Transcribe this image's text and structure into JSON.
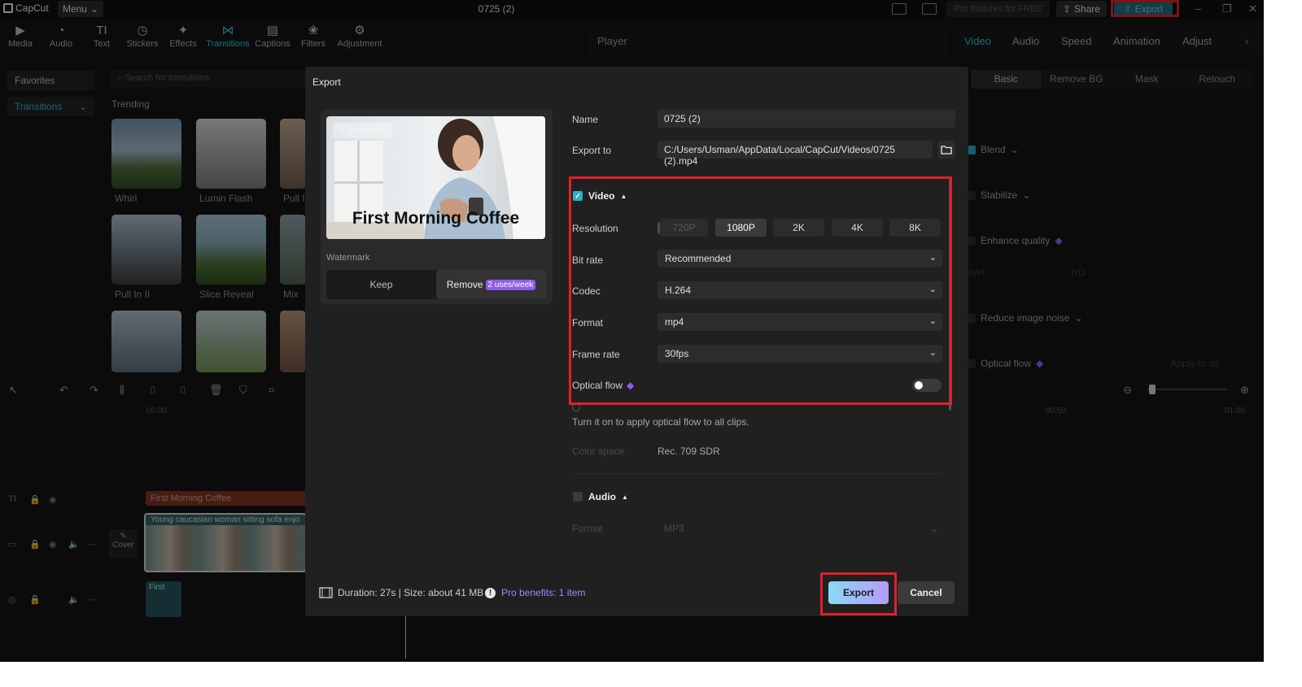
{
  "app": {
    "logo": "CapCut",
    "menu_label": "Menu",
    "project_title": "0725 (2)",
    "pro_features_label": "Pro features for FREE",
    "share_label": "Share",
    "export_label": "Export"
  },
  "toolbar": {
    "items": [
      {
        "label": "Media",
        "icon": "media-icon"
      },
      {
        "label": "Audio",
        "icon": "audio-icon"
      },
      {
        "label": "Text",
        "icon": "text-icon"
      },
      {
        "label": "Stickers",
        "icon": "stickers-icon"
      },
      {
        "label": "Effects",
        "icon": "effects-icon"
      },
      {
        "label": "Transitions",
        "icon": "transitions-icon",
        "active": true
      },
      {
        "label": "Captions",
        "icon": "captions-icon"
      },
      {
        "label": "Filters",
        "icon": "filters-icon"
      },
      {
        "label": "Adjustment",
        "icon": "adjustment-icon"
      }
    ]
  },
  "left_panel": {
    "nav": [
      "Favorites",
      "Transitions"
    ],
    "search_placeholder": "Search for transitions",
    "section": "Trending",
    "transitions": [
      "Whirl",
      "Lumin Flash",
      "Pull I",
      "Pull In II",
      "Slice Reveal",
      "Mix"
    ]
  },
  "player": {
    "title": "Player"
  },
  "right_panel": {
    "tabs": [
      "Video",
      "Audio",
      "Speed",
      "Animation",
      "Adjust"
    ],
    "subtabs": [
      "Basic",
      "Remove BG",
      "Mask",
      "Retouch"
    ],
    "props": [
      "Blend",
      "Stabilize",
      "Enhance quality",
      "Reduce image noise",
      "Optical flow"
    ],
    "level_label": "evel",
    "level_value": "HD",
    "apply_all": "Apply to all"
  },
  "timeline": {
    "ruler_start": "00:00",
    "ruler_mid": "00:50",
    "ruler_end": "01:00",
    "text_clip": "First Morning Coffee",
    "video_clip": "Young caucasian woman sitting sofa enjo",
    "cover_label": "Cover",
    "audio_clip": "First"
  },
  "export_dialog": {
    "title": "Export",
    "edit_cover": "Edit cover",
    "cover_caption": "First Morning Coffee",
    "watermark_label": "Watermark",
    "keep_label": "Keep",
    "remove_label": "Remove",
    "remove_badge": "2 uses/week",
    "name_label": "Name",
    "name_value": "0725 (2)",
    "export_to_label": "Export to",
    "export_to_value": "C:/Users/Usman/AppData/Local/CapCut/Videos/0725 (2).mp4",
    "video_section": "Video",
    "video_checked": true,
    "resolution_label": "Resolution",
    "resolutions": [
      "720P",
      "1080P",
      "2K",
      "4K",
      "8K"
    ],
    "resolution_selected": "1080P",
    "bitrate_label": "Bit rate",
    "bitrate_value": "Recommended",
    "codec_label": "Codec",
    "codec_value": "H.264",
    "format_label": "Format",
    "format_value": "mp4",
    "framerate_label": "Frame rate",
    "framerate_value": "30fps",
    "optical_flow_label": "Optical flow",
    "optical_flow_on": false,
    "optical_flow_hint": "Turn it on to apply optical flow to all clips.",
    "color_space_label": "Color space",
    "color_space_value": "Rec. 709 SDR",
    "audio_section": "Audio",
    "audio_checked": false,
    "audio_format_label": "Format",
    "audio_format_value": "MP3",
    "footer_info": "Duration: 27s | Size: about 41 MB",
    "pro_benefits": "Pro benefits: 1 item",
    "export_button": "Export",
    "cancel_button": "Cancel"
  },
  "colors": {
    "accent": "#2bb7c6",
    "highlight_box": "#e0202a",
    "pro_purple": "#8f5cf0"
  }
}
